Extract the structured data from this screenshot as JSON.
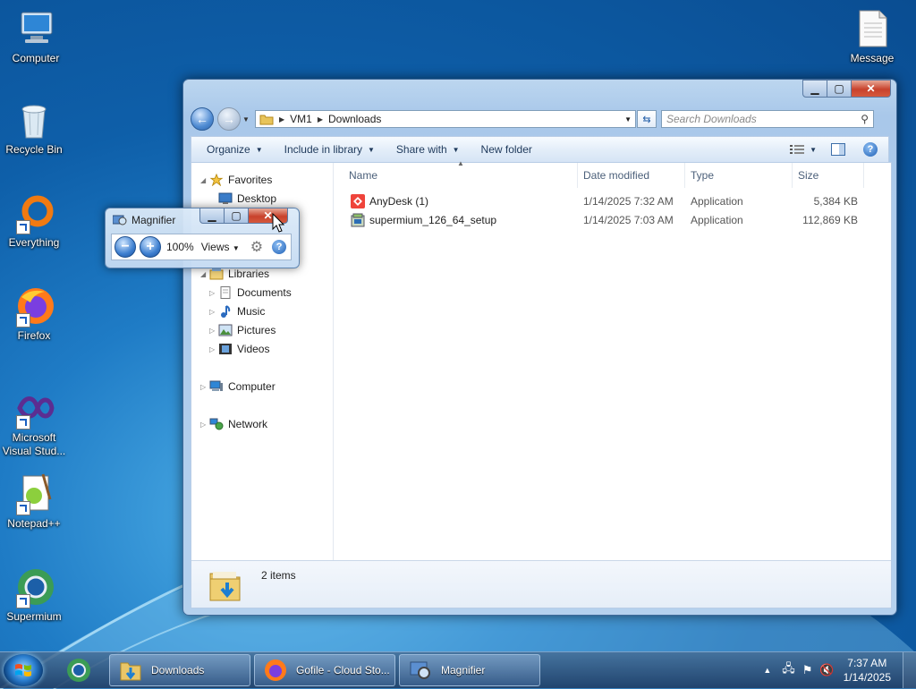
{
  "desktop": {
    "icons": [
      {
        "label": "Computer"
      },
      {
        "label": "Recycle Bin"
      },
      {
        "label": "Everything"
      },
      {
        "label": "Firefox"
      },
      {
        "label": "Microsoft Visual Stud..."
      },
      {
        "label": "Notepad++"
      },
      {
        "label": "Supermium"
      },
      {
        "label": "Message"
      }
    ]
  },
  "explorer": {
    "breadcrumb": [
      "VM1",
      "Downloads"
    ],
    "search_placeholder": "Search Downloads",
    "toolbar": {
      "organize": "Organize",
      "include": "Include in library",
      "share": "Share with",
      "new_folder": "New folder"
    },
    "nav": {
      "favorites": "Favorites",
      "desktop": "Desktop",
      "libraries": "Libraries",
      "documents": "Documents",
      "music": "Music",
      "pictures": "Pictures",
      "videos": "Videos",
      "computer": "Computer",
      "network": "Network"
    },
    "columns": {
      "name": "Name",
      "date": "Date modified",
      "type": "Type",
      "size": "Size"
    },
    "files": [
      {
        "name": "AnyDesk (1)",
        "date": "1/14/2025 7:32 AM",
        "type": "Application",
        "size": "5,384 KB"
      },
      {
        "name": "supermium_126_64_setup",
        "date": "1/14/2025 7:03 AM",
        "type": "Application",
        "size": "112,869 KB"
      }
    ],
    "status": "2 items"
  },
  "magnifier": {
    "title": "Magnifier",
    "zoom": "100%",
    "views": "Views"
  },
  "taskbar": {
    "buttons": [
      {
        "label": "Downloads"
      },
      {
        "label": "Gofile - Cloud Sto..."
      },
      {
        "label": "Magnifier"
      }
    ],
    "time": "7:37 AM",
    "date": "1/14/2025"
  }
}
